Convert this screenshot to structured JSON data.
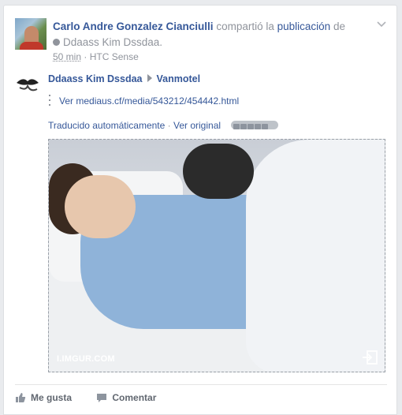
{
  "post": {
    "author": "Carlo Andre Gonzalez Cianciulli",
    "action_text": "compartió la",
    "action_link": "publicación",
    "action_prep": "de",
    "shared_from": "Ddaass Kim Dssdaa.",
    "time": "50 min",
    "meta_sep": "·",
    "device": "HTC Sense"
  },
  "shared": {
    "author": "Ddaass Kim Dssdaa",
    "target": "Vanmotel",
    "link_text": "Ver mediaus.cf/media/543212/454442.html",
    "translated_label": "Traducido automáticamente",
    "translate_sep": "·",
    "see_original": "Ver original",
    "media_source": "I.IMGUR.COM"
  },
  "actions": {
    "like": "Me gusta",
    "comment": "Comentar"
  },
  "icons": {
    "menu": "chevron-down-icon",
    "like": "thumbs-up-icon",
    "comment": "speech-bubble-icon",
    "expand": "external-link-icon"
  }
}
